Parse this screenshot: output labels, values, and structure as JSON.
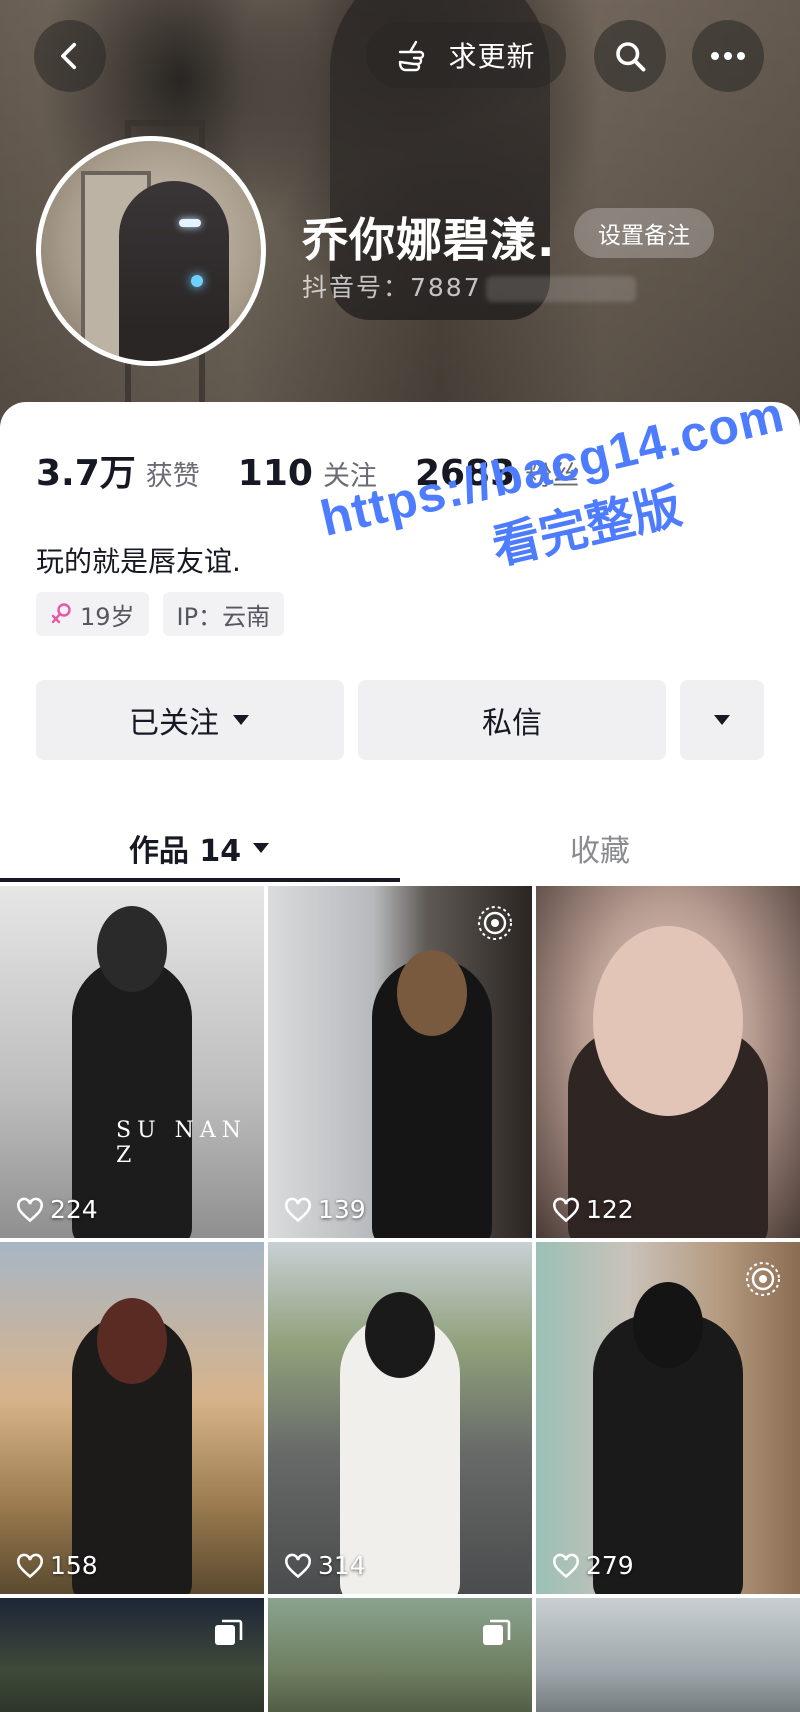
{
  "header": {
    "update_label": "求更新",
    "nickname": "乔你娜碧漾.",
    "remark_label": "设置备注",
    "account_id": "抖音号：7887"
  },
  "stats": {
    "likes_num": "3.7万",
    "likes_label": "获赞",
    "following_num": "110",
    "following_label": "关注",
    "followers_num": "2683",
    "followers_label": "粉丝"
  },
  "profile": {
    "bio": "玩的就是唇友谊.",
    "age_tag": "19岁",
    "ip_tag": "IP：云南"
  },
  "watermark": {
    "line1": "https://bacg14.com",
    "line2": "看完整版"
  },
  "actions": {
    "follow_label": "已关注",
    "message_label": "私信"
  },
  "tabs": {
    "works_label": "作品 14",
    "favorites_label": "收藏"
  },
  "videos": [
    {
      "likes": "224",
      "caption": "SU NAN Z"
    },
    {
      "likes": "139"
    },
    {
      "likes": "122"
    },
    {
      "likes": "158"
    },
    {
      "likes": "314"
    },
    {
      "likes": "279"
    }
  ],
  "icons": {
    "back": "chevron-left-icon",
    "update": "pointing-hand-icon",
    "search": "search-icon",
    "more": "more-dots-icon",
    "gender": "female-icon",
    "dropdown": "caret-down-icon",
    "like": "heart-icon",
    "live_photo": "live-photo-icon",
    "multi_image": "multi-image-icon"
  },
  "colors": {
    "accent_text": "#161823",
    "muted_text": "#6b6c73",
    "gender_pink": "#e857a6",
    "watermark_blue": "#4d7cff"
  }
}
